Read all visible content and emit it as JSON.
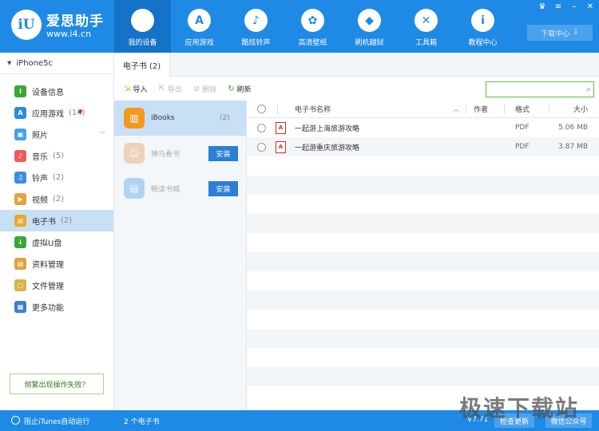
{
  "app": {
    "name": "爱思助手",
    "url": "www.i4.cn",
    "logo_text": "iU"
  },
  "nav": [
    {
      "label": "我的设备",
      "icon": "apple-icon",
      "glyph": "",
      "active": true
    },
    {
      "label": "应用游戏",
      "icon": "app-store-icon",
      "glyph": "A"
    },
    {
      "label": "酷炫铃声",
      "icon": "bell-icon",
      "glyph": "♪"
    },
    {
      "label": "高清壁纸",
      "icon": "flower-icon",
      "glyph": "✿"
    },
    {
      "label": "刷机越狱",
      "icon": "dropbox-icon",
      "glyph": "◆"
    },
    {
      "label": "工具箱",
      "icon": "tools-icon",
      "glyph": "✕"
    },
    {
      "label": "教程中心",
      "icon": "info-icon",
      "glyph": "i"
    }
  ],
  "window_controls": [
    "shirt-icon",
    "menu-icon",
    "minimize-icon",
    "close-icon"
  ],
  "download_center": "下载中心",
  "sidebar": {
    "device": "iPhone5c",
    "items": [
      {
        "label": "设备信息",
        "count": "",
        "icon": "info-icon",
        "color": "#3aa63a",
        "glyph": "i"
      },
      {
        "label": "应用游戏",
        "count": "(14)",
        "icon": "app-store-icon",
        "color": "#2d8ae2",
        "glyph": "A",
        "dot": true
      },
      {
        "label": "照片",
        "count": "",
        "icon": "photo-icon",
        "color": "#47a0e8",
        "glyph": "▣",
        "chevron": true
      },
      {
        "label": "音乐",
        "count": "(5)",
        "icon": "music-icon",
        "color": "#ef5a5a",
        "glyph": "♪"
      },
      {
        "label": "铃声",
        "count": "(2)",
        "icon": "bell-icon",
        "color": "#3b8ee0",
        "glyph": "♫"
      },
      {
        "label": "视频",
        "count": "(2)",
        "icon": "video-icon",
        "color": "#e5a33c",
        "glyph": "▶"
      },
      {
        "label": "电子书",
        "count": "(2)",
        "icon": "book-icon",
        "color": "#f0a528",
        "glyph": "▤",
        "active": true
      },
      {
        "label": "虚拟U盘",
        "count": "",
        "icon": "usb-icon",
        "color": "#3aa63a",
        "glyph": "↓"
      },
      {
        "label": "资料管理",
        "count": "",
        "icon": "contacts-icon",
        "color": "#e1a23a",
        "glyph": "▤"
      },
      {
        "label": "文件管理",
        "count": "",
        "icon": "file-icon",
        "color": "#d9b24a",
        "glyph": "▢"
      },
      {
        "label": "更多功能",
        "count": "",
        "icon": "grid-icon",
        "color": "#3b7fd0",
        "glyph": "▦"
      }
    ],
    "help_button": "频繁出现操作失败？"
  },
  "tab": {
    "label": "电子书 (2)"
  },
  "toolbar": {
    "import": "导入",
    "export": "导出",
    "delete": "删除",
    "refresh": "刷新",
    "search_placeholder": ""
  },
  "apps": [
    {
      "name": "iBooks",
      "count": "(2)",
      "icon": "ibooks-icon",
      "color": "#f39a1e",
      "glyph": "▥",
      "active": true
    },
    {
      "name": "神马看书",
      "button": "安装",
      "icon": "shenma-icon",
      "color": "#e9a56b",
      "glyph": "☺"
    },
    {
      "name": "畅读书城",
      "button": "安装",
      "icon": "changdu-icon",
      "color": "#5ea9e8",
      "glyph": "▤"
    }
  ],
  "table": {
    "headers": {
      "name": "电子书名称",
      "author": "作者",
      "format": "格式",
      "size": "大小"
    },
    "rows": [
      {
        "name": "一起游上海旅游攻略",
        "author": "",
        "format": "PDF",
        "size": "5.06 MB"
      },
      {
        "name": "一起游重庆旅游攻略",
        "author": "",
        "format": "PDF",
        "size": "3.87 MB"
      }
    ]
  },
  "status": {
    "itunes": "阻止iTunes自动运行",
    "count": "2 个电子书",
    "version": "V7.71",
    "check_update": "检查更新",
    "wechat": "微信公众号"
  },
  "watermark": "极速下载站"
}
